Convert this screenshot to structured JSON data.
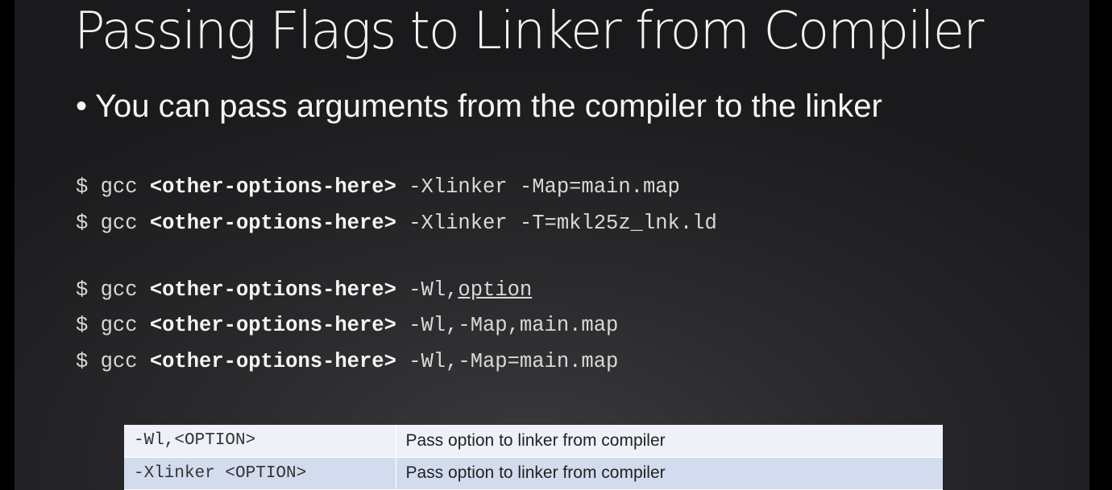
{
  "slide": {
    "title": "Passing Flags to Linker from Compiler",
    "bullet_marker": "•",
    "bullet_text": "You can pass arguments from the compiler to the linker"
  },
  "code_lines": [
    {
      "prefix": "$ gcc ",
      "options": "<other-options-here>",
      "flag": " -Xlinker -Map=main.map",
      "underlined": ""
    },
    {
      "prefix": "$ gcc ",
      "options": "<other-options-here>",
      "flag": " -Xlinker -T=mkl25z_lnk.ld",
      "underlined": ""
    },
    {
      "prefix": "$ gcc ",
      "options": "<other-options-here>",
      "flag": " -Wl,",
      "underlined": "option"
    },
    {
      "prefix": "$ gcc ",
      "options": "<other-options-here>",
      "flag": " -Wl,-Map,main.map",
      "underlined": ""
    },
    {
      "prefix": "$ gcc ",
      "options": "<other-options-here>",
      "flag": " -Wl,-Map=main.map",
      "underlined": ""
    }
  ],
  "reference_table": {
    "rows": [
      {
        "flag": "-Wl,<OPTION>",
        "description": "Pass option to linker from compiler"
      },
      {
        "flag": "-Xlinker <OPTION>",
        "description": "Pass option to linker from compiler"
      }
    ]
  },
  "colors": {
    "background": "#2a292c",
    "title_text": "#f2f2f2",
    "code_text": "#d9d9d9",
    "table_row_light": "#eef1f8",
    "table_row_dark": "#d3dcee"
  }
}
